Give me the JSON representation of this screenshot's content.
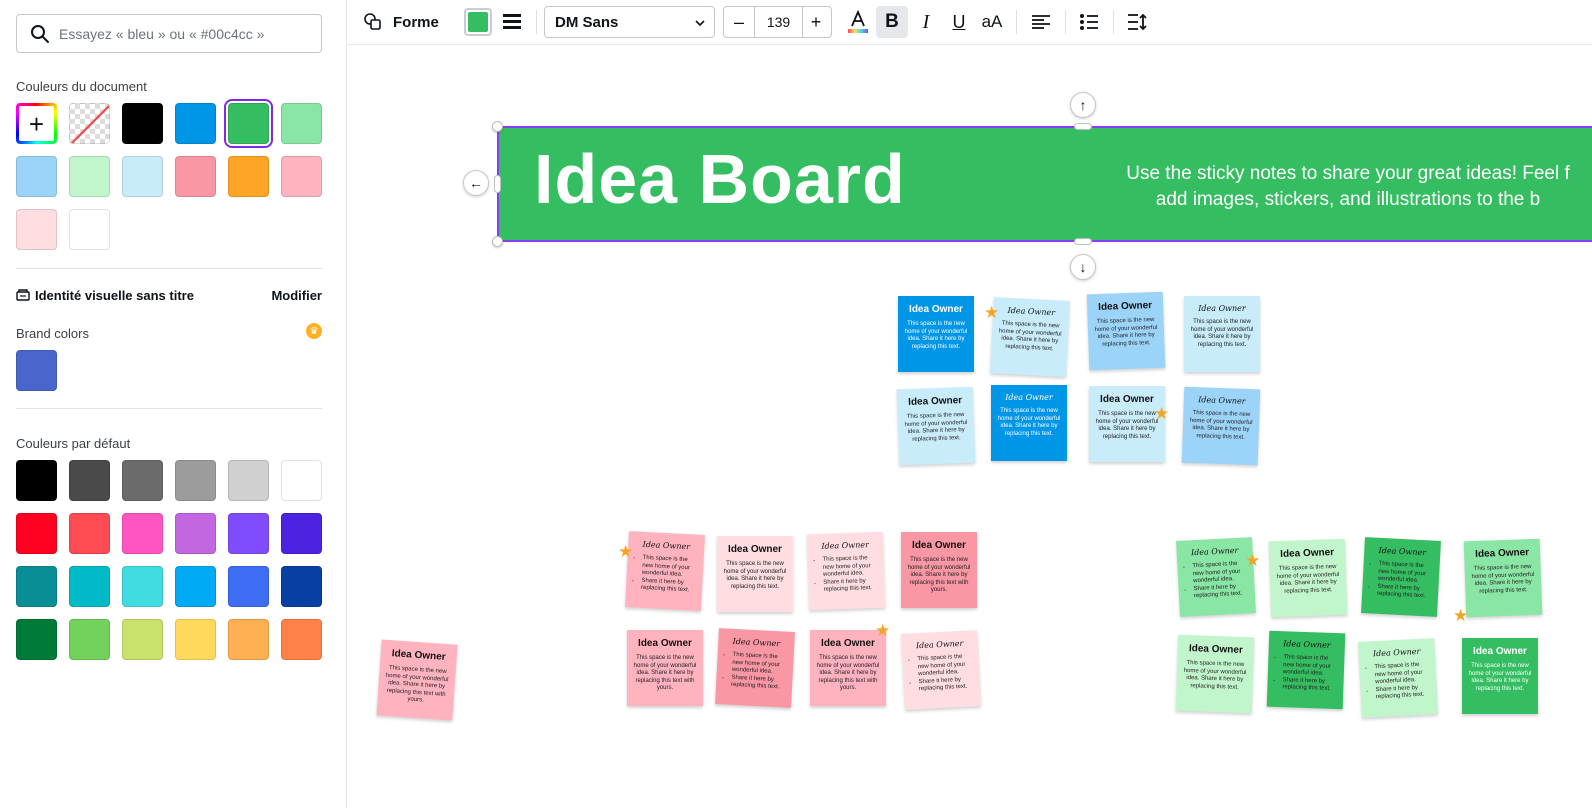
{
  "panel": {
    "search_placeholder": "Essayez « bleu » ou « #00c4cc »",
    "document_colors_title": "Couleurs du document",
    "document_colors": [
      "add",
      "none",
      "#000000",
      "#0096e8",
      "#35be61",
      "#89e6a5",
      "#9cd4f9",
      "#c1f5cb",
      "#c9ecfb",
      "#fa97a5",
      "#ffa526",
      "#ffb3be",
      "#ffdde1",
      "#ffffff"
    ],
    "document_selected_index": 4,
    "brand_kit_name": "Identité visuelle sans titre",
    "brand_kit_edit": "Modifier",
    "brand_colors_title": "Brand colors",
    "brand_colors": [
      "#4a66cc"
    ],
    "default_colors_title": "Couleurs par défaut",
    "default_colors": [
      "#000000",
      "#4a4a4a",
      "#6b6b6b",
      "#9c9c9c",
      "#d0d0d0",
      "#ffffff",
      "#ff0020",
      "#ff4b52",
      "#ff55c2",
      "#c266e2",
      "#7f4dfd",
      "#4b23e0",
      "#0a8e95",
      "#00bbc7",
      "#41dce2",
      "#00aaf5",
      "#3d6df2",
      "#073fa3",
      "#007a37",
      "#72d25b",
      "#c9e26b",
      "#ffd95c",
      "#ffb053",
      "#ff8148"
    ]
  },
  "toolbar": {
    "shape_label": "Forme",
    "fill_color": "#35be61",
    "font_name": "DM Sans",
    "size_minus": "–",
    "font_size": "139",
    "size_plus": "+"
  },
  "canvas": {
    "banner_title": "Idea Board",
    "banner_subtitle_line1": "Use the sticky notes to share your great ideas! Feel f",
    "banner_subtitle_line2": "add images, stickers, and illustrations to the b",
    "banner_color": "#35be61",
    "notes": [
      {
        "owner": "Idea Owner",
        "body": "This space is the new home of your wonderful idea. Share it here by replacing this text.",
        "bullets": [],
        "color": "#0096e8",
        "script": false,
        "dark": true
      },
      {
        "owner": "Idea Owner",
        "body": "This space is the new home of your wonderful idea. Share it here by replacing this text.",
        "bullets": [],
        "color": "#c9ecfb",
        "script": true,
        "dark": false
      },
      {
        "owner": "Idea Owner",
        "body": "This space is the new home of your wonderful idea. Share it here by replacing this text.",
        "bullets": [],
        "color": "#9cd4f9",
        "script": false,
        "dark": false
      },
      {
        "owner": "Idea Owner",
        "body": "This space is the new home of your wonderful idea. Share it here by replacing this text.",
        "bullets": [],
        "color": "#c9ecfb",
        "script": true,
        "dark": false
      },
      {
        "owner": "Idea Owner",
        "body": "This space is the new home of your wonderful idea. Share it here by replacing this text.",
        "bullets": [],
        "color": "#c9ecfb",
        "script": false,
        "dark": false
      },
      {
        "owner": "Idea Owner",
        "body": "This space is the new home of your wonderful idea. Share it here by replacing this text.",
        "bullets": [],
        "color": "#0096e8",
        "script": true,
        "dark": true
      },
      {
        "owner": "Idea Owner",
        "body": "This space is the new home of your wonderful idea. Share it here by replacing this text.",
        "bullets": [],
        "color": "#c9ecfb",
        "script": false,
        "dark": false
      },
      {
        "owner": "Idea Owner",
        "body": "This space is the new home of your wonderful idea. Share it here by replacing this text.",
        "bullets": [],
        "color": "#9cd4f9",
        "script": true,
        "dark": false
      },
      {
        "owner": "Idea Owner",
        "body": "",
        "bullets": [
          "This space is the new home of your wonderful idea.",
          "Share it here by replacing this text."
        ],
        "color": "#ffb3be",
        "script": true,
        "dark": false
      },
      {
        "owner": "Idea Owner",
        "body": "This space is the new home of your wonderful idea. Share it here by replacing this text.",
        "bullets": [],
        "color": "#ffdde1",
        "script": false,
        "dark": false
      },
      {
        "owner": "Idea Owner",
        "body": "",
        "bullets": [
          "This space is the new home of your wonderful idea.",
          "Share it here by replacing this text."
        ],
        "color": "#ffdde1",
        "script": true,
        "dark": false
      },
      {
        "owner": "Idea Owner",
        "body": "This space is the new home of your wonderful idea. Share it here by replacing this text with yours.",
        "bullets": [],
        "color": "#fa97a5",
        "script": false,
        "dark": false
      },
      {
        "owner": "Idea Owner",
        "body": "This space is the new home of your wonderful idea. Share it here by replacing this text with yours.",
        "bullets": [],
        "color": "#ffb3be",
        "script": false,
        "dark": false
      },
      {
        "owner": "Idea Owner",
        "body": "",
        "bullets": [
          "This space is the new home of your wonderful idea.",
          "Share it here by replacing this text."
        ],
        "color": "#fa97a5",
        "script": true,
        "dark": false
      },
      {
        "owner": "Idea Owner",
        "body": "This space is the new home of your wonderful idea. Share it here by replacing this text with yours.",
        "bullets": [],
        "color": "#ffb3be",
        "script": false,
        "dark": false
      },
      {
        "owner": "Idea Owner",
        "body": "",
        "bullets": [
          "This space is the new home of your wonderful idea.",
          "Share it here by replacing this text."
        ],
        "color": "#ffdde1",
        "script": true,
        "dark": false
      },
      {
        "owner": "Idea Owner",
        "body": "This space is the new home of your wonderful idea. Share it here by replacing this text with yours.",
        "bullets": [],
        "color": "#ffb3be",
        "script": false,
        "dark": false
      },
      {
        "owner": "Idea Owner",
        "body": "",
        "bullets": [
          "This space is the new home of your wonderful idea.",
          "Share it here by replacing this text."
        ],
        "color": "#89e6a5",
        "script": true,
        "dark": false
      },
      {
        "owner": "Idea Owner",
        "body": "This space is the new home of your wonderful idea. Share it here by replacing this text.",
        "bullets": [],
        "color": "#c1f5cb",
        "script": false,
        "dark": false
      },
      {
        "owner": "Idea Owner",
        "body": "",
        "bullets": [
          "This space is the new home of your wonderful idea.",
          "Share it here by replacing this text."
        ],
        "color": "#35be61",
        "script": true,
        "dark": false
      },
      {
        "owner": "Idea Owner",
        "body": "This space is the new home of your wonderful idea. Share it here by replacing this text.",
        "bullets": [],
        "color": "#89e6a5",
        "script": false,
        "dark": false
      },
      {
        "owner": "Idea Owner",
        "body": "This space is the new home of your wonderful idea. Share it here by replacing this text.",
        "bullets": [],
        "color": "#c1f5cb",
        "script": false,
        "dark": false
      },
      {
        "owner": "Idea Owner",
        "body": "",
        "bullets": [
          "This space is the new home of your wonderful idea.",
          "Share it here by replacing this text."
        ],
        "color": "#35be61",
        "script": true,
        "dark": false
      },
      {
        "owner": "Idea Owner",
        "body": "",
        "bullets": [
          "This space is the new home of your wonderful idea.",
          "Share it here by replacing this text."
        ],
        "color": "#c1f5cb",
        "script": true,
        "dark": false
      },
      {
        "owner": "Idea Owner",
        "body": "This space is the new home of your wonderful idea. Share it here by replacing this text.",
        "bullets": [],
        "color": "#35be61",
        "script": false,
        "dark": true
      }
    ]
  }
}
